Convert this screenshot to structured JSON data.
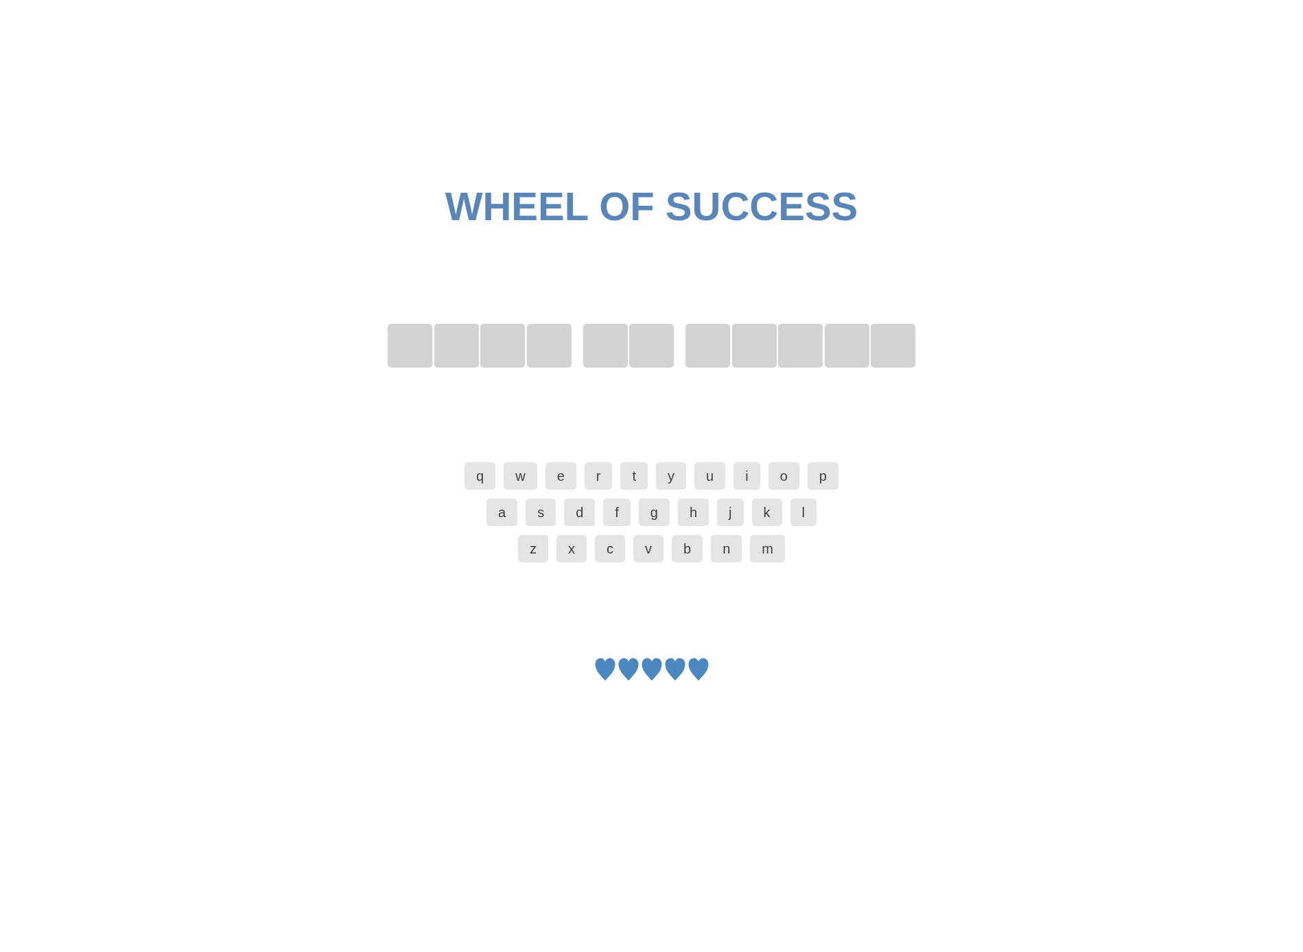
{
  "title": "WHEEL OF SUCCESS",
  "puzzle": {
    "words": [
      {
        "tiles": [
          {
            "revealed": false
          },
          {
            "revealed": false
          },
          {
            "revealed": false
          },
          {
            "revealed": false
          }
        ]
      },
      {
        "tiles": [
          {
            "revealed": false
          },
          {
            "revealed": false
          }
        ]
      },
      {
        "tiles": [
          {
            "revealed": false
          },
          {
            "revealed": false
          },
          {
            "revealed": false
          },
          {
            "revealed": false
          },
          {
            "revealed": false
          }
        ]
      }
    ]
  },
  "keyboard": {
    "rows": [
      {
        "keys": [
          "q",
          "w",
          "e",
          "r",
          "t",
          "y",
          "u",
          "i",
          "o",
          "p"
        ]
      },
      {
        "keys": [
          "a",
          "s",
          "d",
          "f",
          "g",
          "h",
          "j",
          "k",
          "l"
        ]
      },
      {
        "keys": [
          "z",
          "x",
          "c",
          "v",
          "b",
          "n",
          "m"
        ]
      }
    ]
  },
  "lives": [
    {
      "filled": true
    },
    {
      "filled": true
    },
    {
      "filled": true
    },
    {
      "filled": true
    },
    {
      "filled": true
    }
  ]
}
